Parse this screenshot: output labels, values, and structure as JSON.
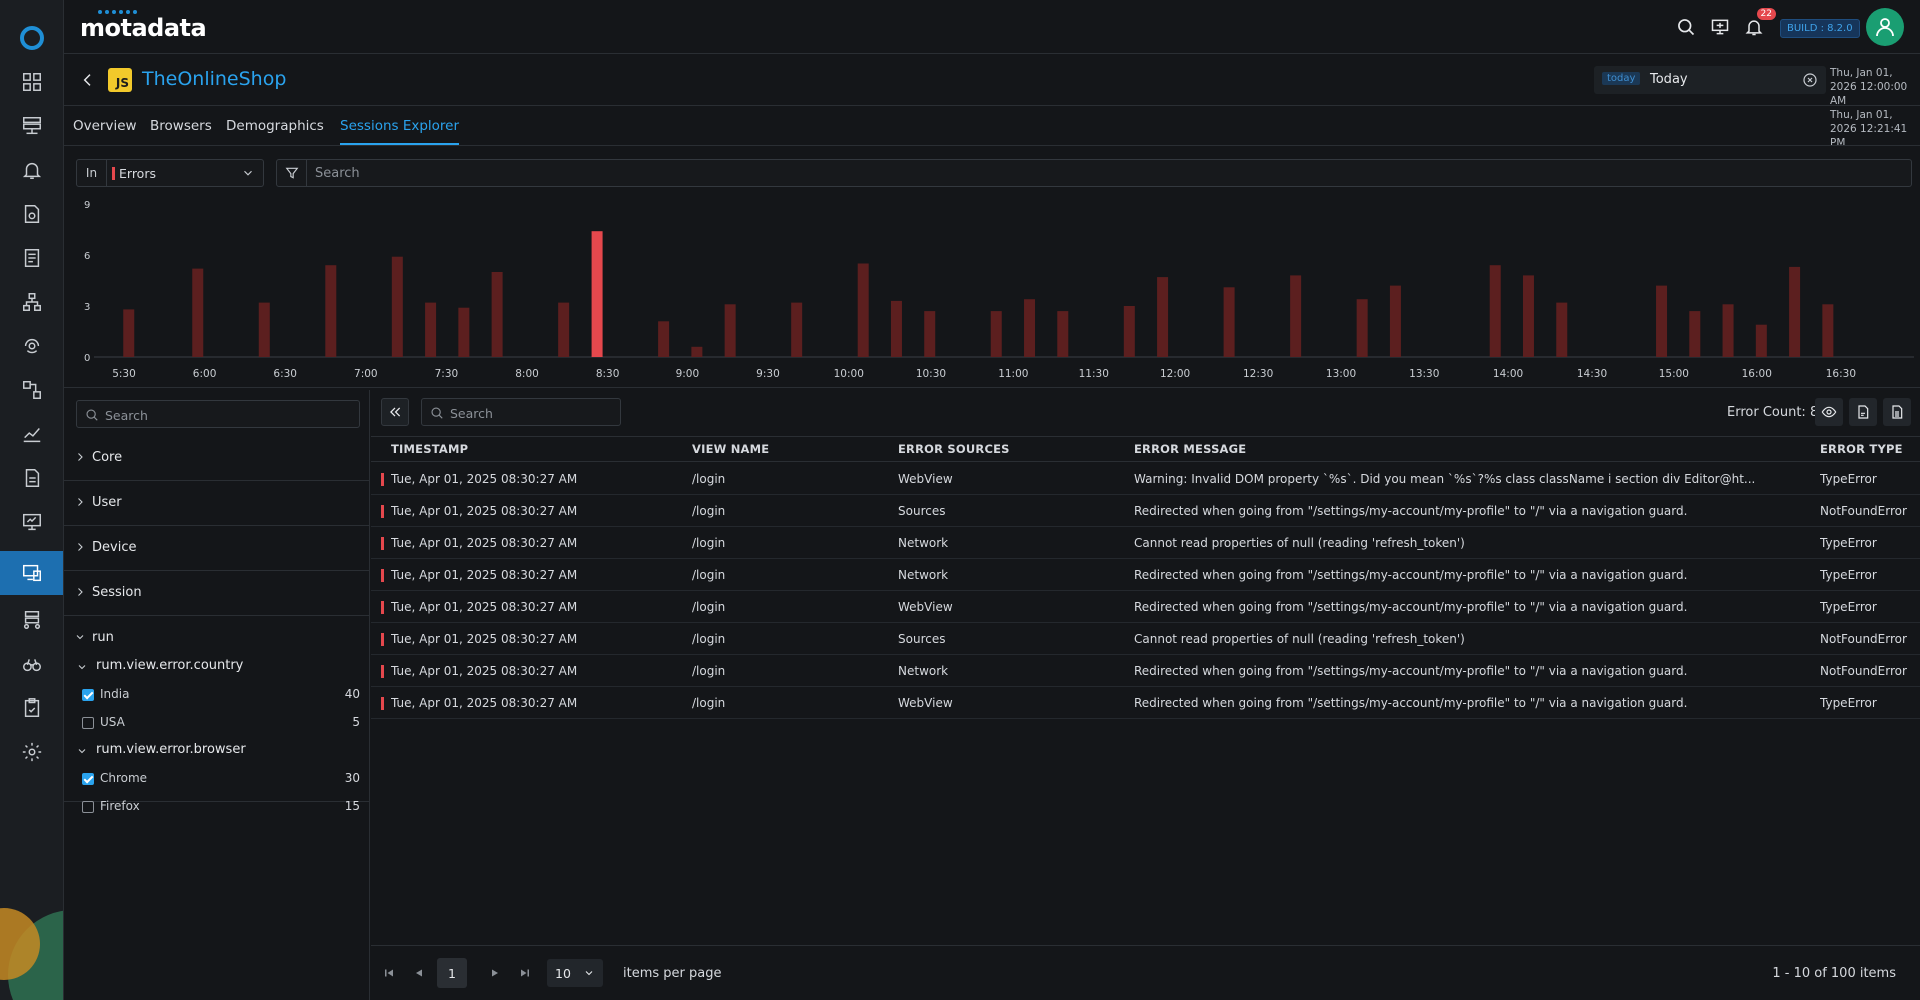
{
  "brand": {
    "name": "motadata"
  },
  "topbar": {
    "notifications_count": "22",
    "build_label": "BUILD : 8.2.0"
  },
  "header": {
    "app_badge": "JS",
    "app_title": "TheOnlineShop",
    "time": {
      "tag": "today",
      "value": "Today",
      "start": "Thu, Jan 01, 2026 12:00:00 AM",
      "end": "Thu, Jan 01, 2026 12:21:41 PM"
    }
  },
  "tabs": [
    "Overview",
    "Browsers",
    "Demographics",
    "Sessions Explorer"
  ],
  "active_tab": "Sessions Explorer",
  "filter": {
    "in_label": "In",
    "selected": "Errors",
    "search_placeholder": "Search"
  },
  "chart_data": {
    "type": "bar",
    "yticks": [
      0,
      3,
      6,
      9
    ],
    "ylim": [
      0,
      9
    ],
    "xlim": [
      0,
      1
    ],
    "xticks": [
      "5:30",
      "6:00",
      "6:30",
      "7:00",
      "7:30",
      "8:00",
      "8:30",
      "9:00",
      "9:30",
      "10:00",
      "10:30",
      "11:00",
      "11:30",
      "12:00",
      "12:30",
      "13:00",
      "13:30",
      "14:00",
      "14:30",
      "15:00",
      "16:00",
      "16:30"
    ],
    "xtick_positions": [
      0.0,
      0.0458,
      0.0916,
      0.1374,
      0.1832,
      0.229,
      0.2748,
      0.3201,
      0.3659,
      0.4118,
      0.4585,
      0.5053,
      0.551,
      0.5972,
      0.6444,
      0.6915,
      0.7388,
      0.7864,
      0.8341,
      0.8806,
      0.9277,
      0.9755
    ],
    "bars": [
      {
        "x": 0.0027,
        "y": 2.8
      },
      {
        "x": 0.0419,
        "y": 5.2
      },
      {
        "x": 0.0797,
        "y": 3.2
      },
      {
        "x": 0.1175,
        "y": 5.4
      },
      {
        "x": 0.1553,
        "y": 5.9
      },
      {
        "x": 0.1742,
        "y": 3.2
      },
      {
        "x": 0.1931,
        "y": 2.9
      },
      {
        "x": 0.212,
        "y": 5.0
      },
      {
        "x": 0.2498,
        "y": 3.2
      },
      {
        "x": 0.2688,
        "y": 7.4,
        "highlight": true
      },
      {
        "x": 0.3066,
        "y": 2.1
      },
      {
        "x": 0.3255,
        "y": 0.6
      },
      {
        "x": 0.3444,
        "y": 3.1
      },
      {
        "x": 0.3822,
        "y": 3.2
      },
      {
        "x": 0.42,
        "y": 5.5
      },
      {
        "x": 0.4389,
        "y": 3.3
      },
      {
        "x": 0.4578,
        "y": 2.7
      },
      {
        "x": 0.4956,
        "y": 2.7
      },
      {
        "x": 0.5145,
        "y": 3.4
      },
      {
        "x": 0.5334,
        "y": 2.7
      },
      {
        "x": 0.5712,
        "y": 3.0
      },
      {
        "x": 0.5901,
        "y": 4.7
      },
      {
        "x": 0.6279,
        "y": 4.1
      },
      {
        "x": 0.6657,
        "y": 4.8
      },
      {
        "x": 0.7035,
        "y": 3.4
      },
      {
        "x": 0.7224,
        "y": 4.2
      },
      {
        "x": 0.7791,
        "y": 5.4
      },
      {
        "x": 0.798,
        "y": 4.8
      },
      {
        "x": 0.8169,
        "y": 3.2
      },
      {
        "x": 0.8736,
        "y": 4.2
      },
      {
        "x": 0.8925,
        "y": 2.7
      },
      {
        "x": 0.9114,
        "y": 3.1
      },
      {
        "x": 0.9303,
        "y": 1.9
      },
      {
        "x": 0.9492,
        "y": 5.3
      },
      {
        "x": 0.9681,
        "y": 3.1
      }
    ],
    "colors": {
      "bar": "#5c1f1f",
      "highlight": "#e5484d"
    }
  },
  "facets": {
    "search_placeholder": "Search",
    "groups": [
      "Core",
      "User",
      "Device",
      "Session"
    ],
    "expanded_group": "run",
    "sub1": {
      "name": "rum.view.error.country",
      "options": [
        {
          "label": "India",
          "count": "40",
          "checked": true
        },
        {
          "label": "USA",
          "count": "5",
          "checked": false
        }
      ]
    },
    "sub2": {
      "name": "rum.view.error.browser",
      "options": [
        {
          "label": "Chrome",
          "count": "30",
          "checked": true
        },
        {
          "label": "Firefox",
          "count": "15",
          "checked": false
        }
      ]
    }
  },
  "grid": {
    "search_placeholder": "Search",
    "error_count_label": "Error Count: 8",
    "columns": [
      "TIMESTAMP",
      "VIEW NAME",
      "ERROR SOURCES",
      "ERROR MESSAGE",
      "ERROR TYPE"
    ],
    "rows": [
      [
        "Tue, Apr 01, 2025 08:30:27 AM",
        "/login",
        "WebView",
        "Warning: Invalid DOM property `%s`. Did you mean `%s`?%s class className i section div Editor@ht...",
        "TypeError"
      ],
      [
        "Tue, Apr 01, 2025 08:30:27 AM",
        "/login",
        "Sources",
        "Redirected when going from \"/settings/my-account/my-profile\" to \"/\" via a navigation guard.",
        "NotFoundError"
      ],
      [
        "Tue, Apr 01, 2025 08:30:27 AM",
        "/login",
        "Network",
        "Cannot read properties of null (reading 'refresh_token')",
        "TypeError"
      ],
      [
        "Tue, Apr 01, 2025 08:30:27 AM",
        "/login",
        "Network",
        "Redirected when going from \"/settings/my-account/my-profile\" to \"/\" via a navigation guard.",
        "TypeError"
      ],
      [
        "Tue, Apr 01, 2025 08:30:27 AM",
        "/login",
        "WebView",
        "Redirected when going from \"/settings/my-account/my-profile\" to \"/\" via a navigation guard.",
        "TypeError"
      ],
      [
        "Tue, Apr 01, 2025 08:30:27 AM",
        "/login",
        "Sources",
        "Cannot read properties of null (reading 'refresh_token')",
        "NotFoundError"
      ],
      [
        "Tue, Apr 01, 2025 08:30:27 AM",
        "/login",
        "Network",
        "Redirected when going from \"/settings/my-account/my-profile\" to \"/\" via a navigation guard.",
        "NotFoundError"
      ],
      [
        "Tue, Apr 01, 2025 08:30:27 AM",
        "/login",
        "WebView",
        "Redirected when going from \"/settings/my-account/my-profile\" to \"/\" via a navigation guard.",
        "TypeError"
      ]
    ]
  },
  "pager": {
    "page": "1",
    "page_size": "10",
    "page_size_label": "items per page",
    "info": "1 - 10 of 100 items"
  },
  "icons": {
    "rail": [
      "dashboard-icon",
      "monitor-icon",
      "alert-bell-icon",
      "apm-icon",
      "log-icon",
      "topology-icon",
      "network-icon",
      "flow-icon",
      "metric-explorer-icon",
      "report-icon",
      "rum-screen-icon",
      "rum-sessions-icon",
      "service-map-icon",
      "binoculars-icon",
      "audit-icon",
      "settings-gear-icon"
    ]
  }
}
